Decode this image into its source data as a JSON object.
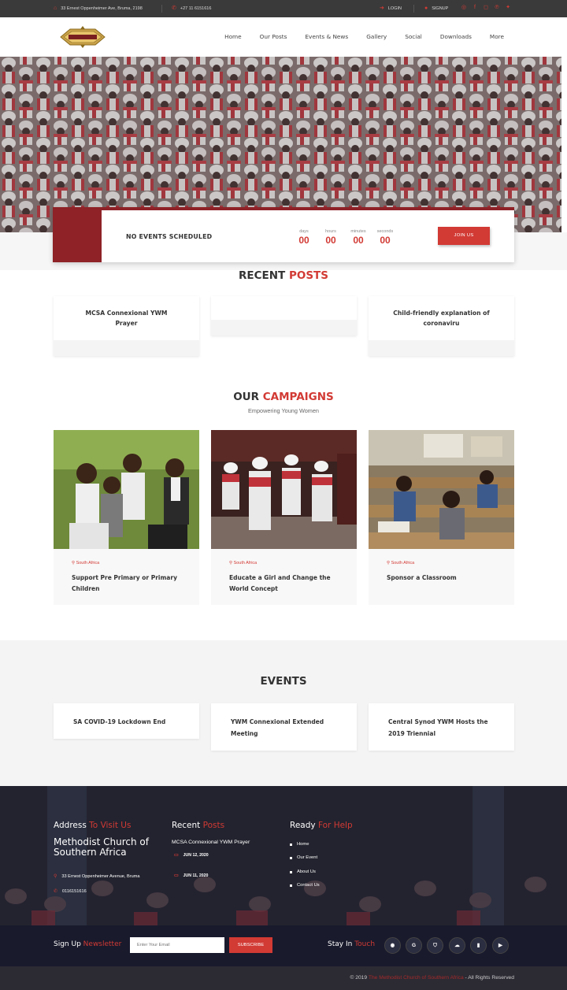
{
  "topbar": {
    "address": "33 Ernest Oppenheimer Ave, Bruma, 2198",
    "phone": "+27 11 6151616",
    "login": "LOGIN",
    "signup": "SIGNUP",
    "social_icons": [
      "whatsapp-icon",
      "facebook-icon",
      "instagram-icon",
      "pinterest-icon",
      "twitter-icon"
    ]
  },
  "logo_text": "M.Y.W.P.&S.U.",
  "nav": [
    "Home",
    "Our Posts",
    "Events & News",
    "Gallery",
    "Social",
    "Downloads",
    "More"
  ],
  "countdown": {
    "status": "NO EVENTS SCHEDULED",
    "units": [
      {
        "label": "days",
        "value": "00"
      },
      {
        "label": "hours",
        "value": "00"
      },
      {
        "label": "minutes",
        "value": "00"
      },
      {
        "label": "seconds",
        "value": "00"
      }
    ],
    "join_label": "JOIN US"
  },
  "recent_posts": {
    "title_a": "RECENT",
    "title_b": "POSTS",
    "items": [
      {
        "title": "MCSA Connexional YWM Prayer"
      },
      {
        "title": ""
      },
      {
        "title": "Child-friendly explanation of coronaviru"
      }
    ]
  },
  "campaigns": {
    "title_a": "OUR",
    "title_b": "CAMPAIGNS",
    "subtitle": "Empowering Young Women",
    "items": [
      {
        "location": "South Africa",
        "title": "Support Pre Primary or Primary Children"
      },
      {
        "location": "South Africa",
        "title": "Educate a Girl and Change the World Concept"
      },
      {
        "location": "South Africa",
        "title": "Sponsor a Classroom"
      }
    ]
  },
  "events": {
    "title": "EVENTS",
    "items": [
      {
        "title": "SA COVID-19 Lockdown End"
      },
      {
        "title": "YWM Connexional Extended Meeting"
      },
      {
        "title": "Central Synod YWM Hosts the 2019 Triennial"
      }
    ]
  },
  "footer": {
    "address_head_a": "Address",
    "address_head_b": "To Visit Us",
    "church_name": "Methodist Church of Southern Africa",
    "address": "33 Ernest Oppenheimer Avenue, Bruma",
    "phone": "0116151616",
    "recent_head_a": "Recent",
    "recent_head_b": "Posts",
    "recent_post_title": "MCSA Connexional YWM Prayer",
    "recent_dates": [
      "JUN 12, 2020",
      "JUN 11, 2020"
    ],
    "help_head_a": "Ready",
    "help_head_b": "For Help",
    "links": [
      "Home",
      "Our Event",
      "About Us",
      "Contact Us"
    ]
  },
  "newsletter": {
    "label_a": "Sign Up",
    "label_b": "Newsletter",
    "placeholder": "Enter Your Email",
    "subscribe": "SUBSCRIBE",
    "stay_a": "Stay In",
    "stay_b": "Touch",
    "social_icons": [
      "dribbble-icon",
      "google-icon",
      "shield-icon",
      "cloud-icon",
      "bookmark-icon",
      "youtube-icon"
    ]
  },
  "copyright": {
    "prefix": "© 2019",
    "org": "The Methodist Church of Southern Africa",
    "suffix": "- All Rights Reserved"
  },
  "colors": {
    "accent": "#d23a34",
    "dark_red": "#8e2227",
    "topbar": "#3a3a3a",
    "footer_dark": "#191a2c"
  }
}
